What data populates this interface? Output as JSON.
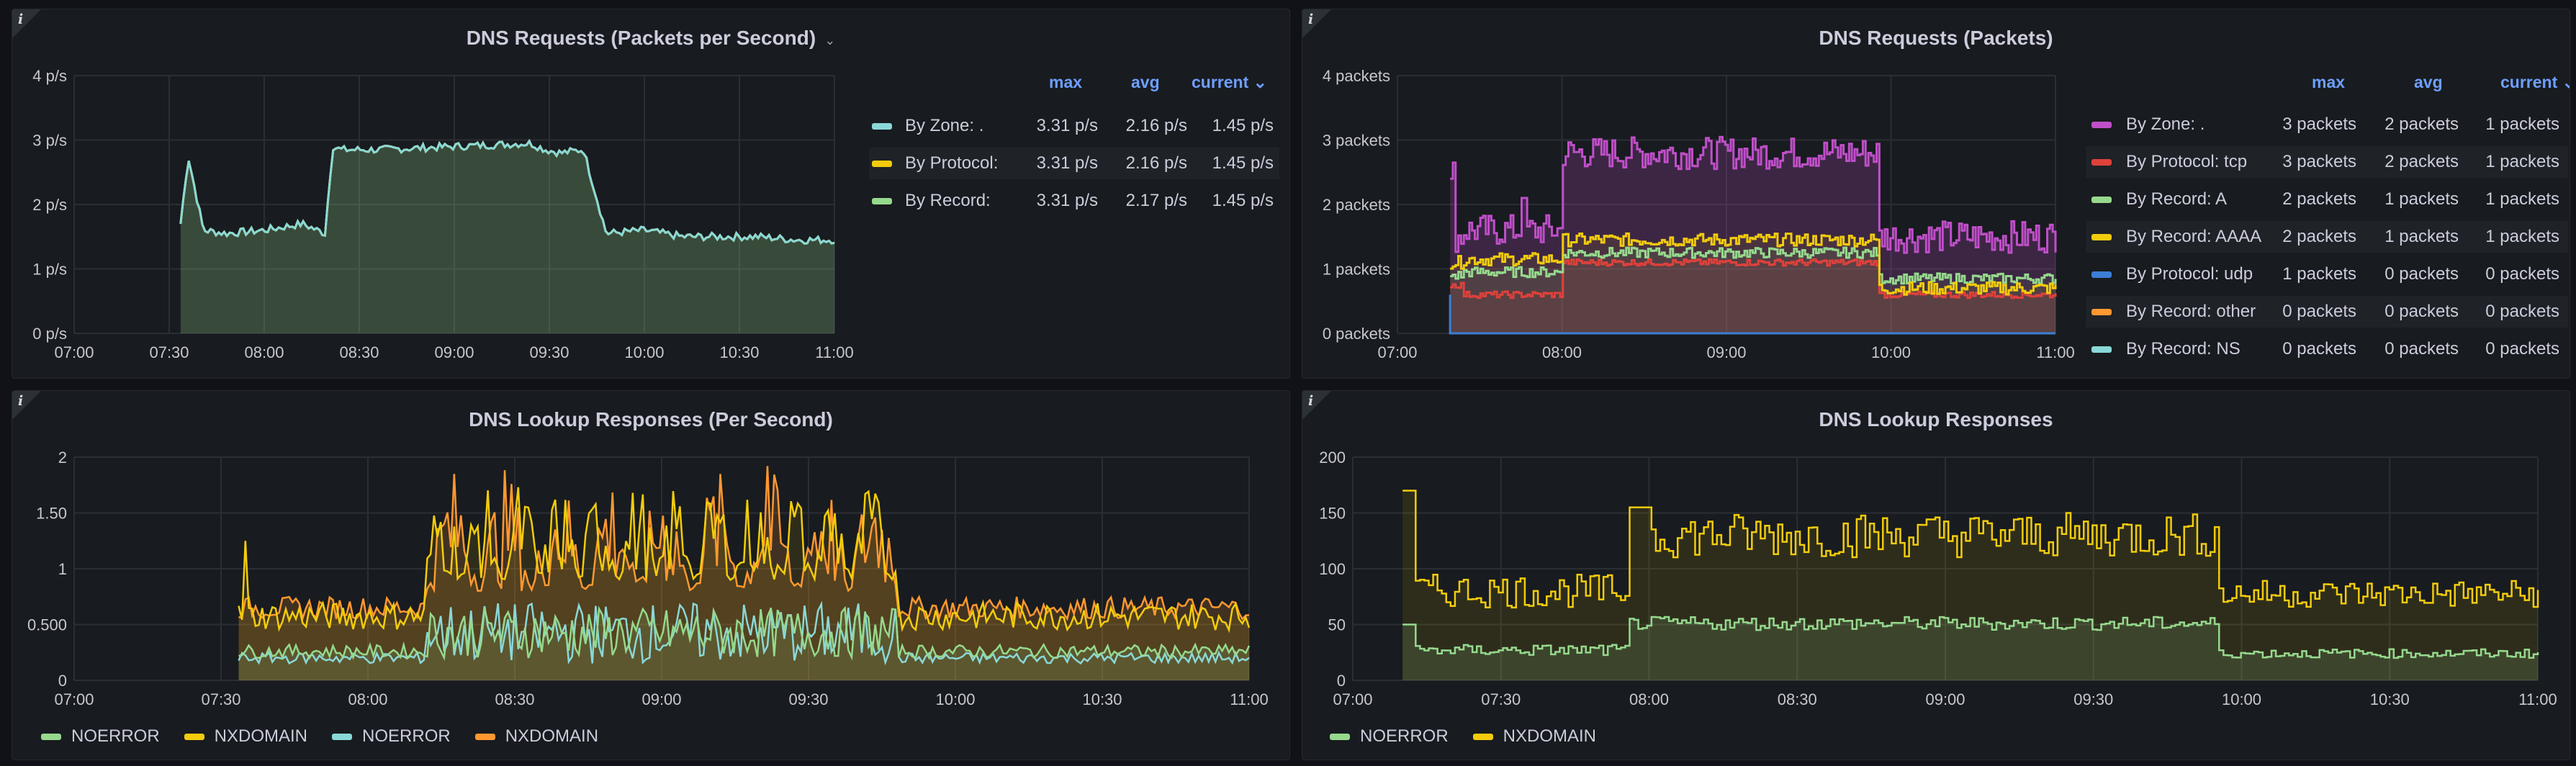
{
  "panels": [
    {
      "id": "p1",
      "title": "DNS Requests (Packets per Second)",
      "has_menu_chevron": true
    },
    {
      "id": "p2",
      "title": "DNS Requests (Packets)",
      "has_menu_chevron": false
    },
    {
      "id": "p3",
      "title": "DNS Lookup Responses (Per Second)",
      "has_menu_chevron": false
    },
    {
      "id": "p4",
      "title": "DNS Lookup Responses",
      "has_menu_chevron": false
    }
  ],
  "legend_headers": {
    "max": "max",
    "avg": "avg",
    "current": "current"
  },
  "colors": {
    "teal": "#8ad8d8",
    "yellow": "#f2cc0c",
    "green": "#96d98d",
    "purple": "#c04fc9",
    "red": "#e0413b",
    "blue": "#3d7ed6",
    "orange": "#ff9830",
    "nxyellow": "#f2c94c"
  },
  "chart_data": [
    {
      "type": "area",
      "title": "DNS Requests (Packets per Second)",
      "x_ticks": [
        "07:00",
        "07:30",
        "08:00",
        "08:30",
        "09:00",
        "09:30",
        "10:00",
        "10:30",
        "11:00"
      ],
      "y_ticks": [
        "0 p/s",
        "1 p/s",
        "2 p/s",
        "3 p/s",
        "4 p/s"
      ],
      "ylim": [
        0,
        4
      ],
      "series": [
        {
          "name": "By Zone: .",
          "color": "#8ad8d8",
          "max": "3.31 p/s",
          "avg": "2.16 p/s",
          "current": "1.45 p/s"
        },
        {
          "name": "By Protocol:",
          "color": "#f2cc0c",
          "max": "3.31 p/s",
          "avg": "2.16 p/s",
          "current": "1.45 p/s"
        },
        {
          "name": "By Record:",
          "color": "#96d98d",
          "max": "3.31 p/s",
          "avg": "2.17 p/s",
          "current": "1.45 p/s"
        }
      ],
      "profile": {
        "x": [
          0.14,
          0.15,
          0.17,
          0.2,
          0.25,
          0.3,
          0.33,
          0.34,
          0.35,
          0.4,
          0.5,
          0.6,
          0.62,
          0.64,
          0.67,
          0.7,
          0.75,
          0.8,
          0.9,
          0.95,
          1.0
        ],
        "y": [
          1.7,
          2.75,
          1.6,
          1.55,
          1.6,
          1.7,
          1.55,
          2.9,
          2.85,
          2.85,
          2.9,
          2.95,
          2.85,
          2.8,
          2.85,
          1.55,
          1.6,
          1.5,
          1.5,
          1.45,
          1.45
        ]
      }
    },
    {
      "type": "line",
      "title": "DNS Requests (Packets)",
      "x_ticks": [
        "07:00",
        "08:00",
        "09:00",
        "10:00",
        "11:00"
      ],
      "y_ticks": [
        "0 packets",
        "1 packets",
        "2 packets",
        "3 packets",
        "4 packets"
      ],
      "ylim": [
        0,
        4
      ],
      "series": [
        {
          "name": "By Zone: .",
          "color": "#c04fc9",
          "max": "3 packets",
          "avg": "2 packets",
          "current": "1 packets"
        },
        {
          "name": "By Protocol: tcp",
          "color": "#e0413b",
          "max": "3 packets",
          "avg": "2 packets",
          "current": "1 packets"
        },
        {
          "name": "By Record: A",
          "color": "#96d98d",
          "max": "2 packets",
          "avg": "1 packets",
          "current": "1 packets"
        },
        {
          "name": "By Record: AAAA",
          "color": "#f2cc0c",
          "max": "2 packets",
          "avg": "1 packets",
          "current": "1 packets"
        },
        {
          "name": "By Protocol: udp",
          "color": "#3d7ed6",
          "max": "1 packets",
          "avg": "0 packets",
          "current": "0 packets"
        },
        {
          "name": "By Record: other",
          "color": "#ff9830",
          "max": "0 packets",
          "avg": "0 packets",
          "current": "0 packets"
        },
        {
          "name": "By Record: NS",
          "color": "#8ad8d8",
          "max": "0 packets",
          "avg": "0 packets",
          "current": "0 packets"
        }
      ]
    },
    {
      "type": "area",
      "title": "DNS Lookup Responses (Per Second)",
      "x_ticks": [
        "07:00",
        "07:30",
        "08:00",
        "08:30",
        "09:00",
        "09:30",
        "10:00",
        "10:30",
        "11:00"
      ],
      "y_ticks": [
        "0",
        "0.500",
        "1",
        "1.50",
        "2"
      ],
      "ylim": [
        0,
        2
      ],
      "series": [
        {
          "name": "NOERROR",
          "color": "#96d98d"
        },
        {
          "name": "NXDOMAIN",
          "color": "#f2cc0c"
        },
        {
          "name": "NOERROR",
          "color": "#8ad8d8"
        },
        {
          "name": "NXDOMAIN",
          "color": "#ff9830"
        }
      ]
    },
    {
      "type": "area",
      "title": "DNS Lookup Responses",
      "x_ticks": [
        "07:00",
        "07:30",
        "08:00",
        "08:30",
        "09:00",
        "09:30",
        "10:00",
        "10:30",
        "11:00"
      ],
      "y_ticks": [
        "0",
        "50",
        "100",
        "150",
        "200"
      ],
      "ylim": [
        0,
        200
      ],
      "series": [
        {
          "name": "NOERROR",
          "color": "#96d98d"
        },
        {
          "name": "NXDOMAIN",
          "color": "#f2cc0c"
        }
      ]
    }
  ]
}
